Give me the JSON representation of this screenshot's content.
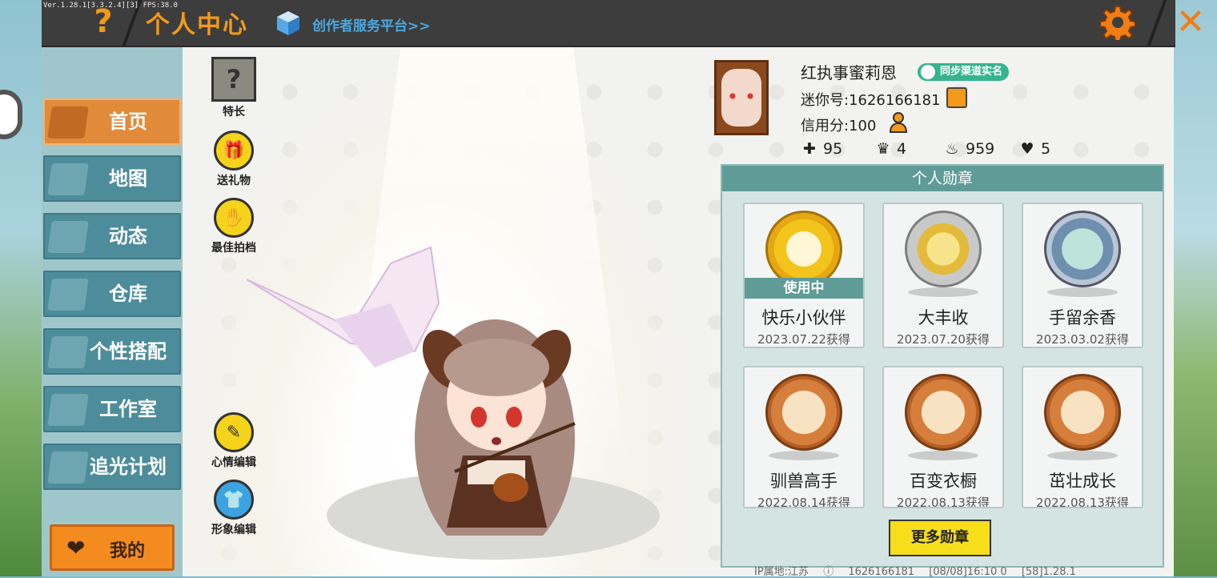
{
  "version_text": "Ver.1.28.1[3.3.2.4][3] FPS:38.0",
  "header": {
    "title": "个人中心",
    "creator_link": "创作者服务平台>>",
    "help_glyph": "?",
    "close_glyph": "✕"
  },
  "sidebar": {
    "items": [
      {
        "label": "首页",
        "active": true
      },
      {
        "label": "地图"
      },
      {
        "label": "动态"
      },
      {
        "label": "仓库"
      },
      {
        "label": "个性搭配"
      },
      {
        "label": "工作室"
      },
      {
        "label": "追光计划"
      }
    ],
    "my_button": "我的"
  },
  "actions": {
    "specialty": "特长",
    "gift": "送礼物",
    "best_partner": "最佳拍档",
    "mood_edit": "心情编辑",
    "avatar_edit": "形象编辑"
  },
  "profile": {
    "name": "红执事蜜莉恩",
    "realname_badge": "同步渠道实名",
    "mini_id": "迷你号:1626166181",
    "credit": "信用分:100",
    "stats": {
      "likes": "95",
      "fans": "4",
      "heat": "959",
      "friends": "5"
    }
  },
  "badges": {
    "title": "个人勋章",
    "in_use_label": "使用中",
    "items": [
      {
        "name": "快乐小伙伴",
        "date": "2023.07.22获得",
        "style": "gold"
      },
      {
        "name": "大丰收",
        "date": "2023.07.20获得",
        "style": "silver"
      },
      {
        "name": "手留余香",
        "date": "2023.03.02获得",
        "style": "blue"
      },
      {
        "name": "驯兽高手",
        "date": "2022.08.14获得",
        "style": "copper"
      },
      {
        "name": "百变衣橱",
        "date": "2022.08.13获得",
        "style": "copper"
      },
      {
        "name": "茁壮成长",
        "date": "2022.08.13获得",
        "style": "copper"
      }
    ],
    "more_button": "更多勋章"
  },
  "footer": {
    "ip_location": "IP属地:江苏",
    "uid": "1626166181",
    "time": "[08/08]16:10 0",
    "build": "[58]1.28.1"
  },
  "colors": {
    "accent_orange": "#f29a1a",
    "nav_teal": "#4d8d9b",
    "badge_teal": "#5f9c98",
    "button_yellow": "#f7de1a"
  }
}
